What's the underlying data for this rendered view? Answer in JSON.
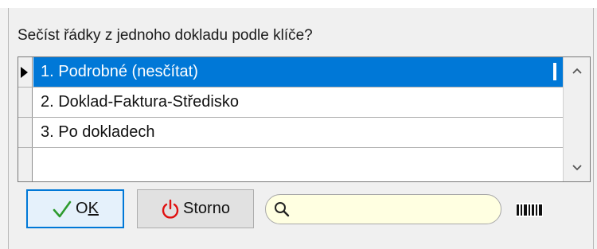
{
  "dialog": {
    "prompt": "Sečíst řádky z jednoho dokladu podle klíče?"
  },
  "options": [
    {
      "label": "1. Podrobné (nesčítat)",
      "selected": true
    },
    {
      "label": "2. Doklad-Faktura-Středisko",
      "selected": false
    },
    {
      "label": "3. Po dokladech",
      "selected": false
    },
    {
      "label": "",
      "selected": false
    }
  ],
  "buttons": {
    "ok": {
      "label": "OK",
      "mnemonic": "K"
    },
    "storno": {
      "label": "Storno"
    }
  },
  "search": {
    "value": "",
    "placeholder": ""
  },
  "colors": {
    "selection": "#0078d7",
    "ok_check": "#2e9b2e",
    "storno_power": "#e01010",
    "search_bg": "#ffffe1"
  },
  "icons": [
    "row-pointer-icon",
    "scroll-up-icon",
    "scroll-down-icon",
    "check-icon",
    "power-icon",
    "search-icon",
    "barcode-icon"
  ]
}
